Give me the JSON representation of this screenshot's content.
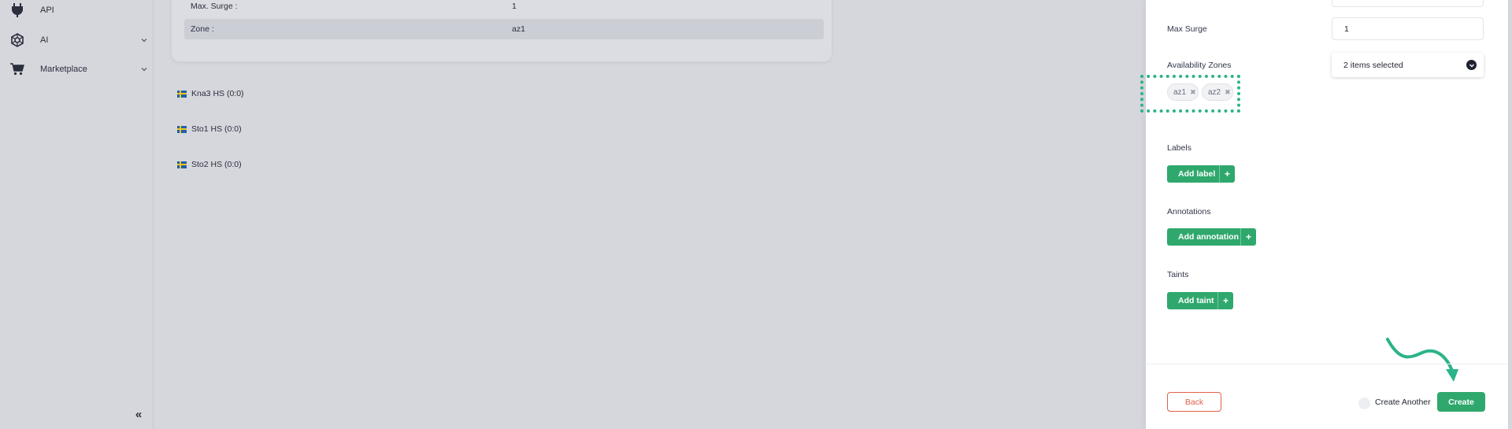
{
  "sidebar": {
    "items": [
      {
        "label": "API",
        "icon": "plug-icon",
        "has_submenu": false
      },
      {
        "label": "AI",
        "icon": "ai-network-icon",
        "has_submenu": true
      },
      {
        "label": "Marketplace",
        "icon": "cart-icon",
        "has_submenu": true
      }
    ],
    "collapse_glyph": "«"
  },
  "details": {
    "rows": [
      {
        "key": "Max. Surge :",
        "value": "1"
      },
      {
        "key": "Zone :",
        "value": "az1"
      }
    ]
  },
  "regions": [
    {
      "label": "Kna3 HS (0:0)"
    },
    {
      "label": "Sto1 HS (0:0)"
    },
    {
      "label": "Sto2 HS (0:0)"
    }
  ],
  "form": {
    "max_surge": {
      "label": "Max Surge",
      "value": "1"
    },
    "availability_zones": {
      "label": "Availability Zones",
      "selected_text": "2 items selected",
      "chips": [
        "az1",
        "az2"
      ]
    },
    "labels": {
      "label": "Labels",
      "button": "Add label"
    },
    "annotations": {
      "label": "Annotations",
      "button": "Add annotation"
    },
    "taints": {
      "label": "Taints",
      "button": "Add taint"
    },
    "footer": {
      "back": "Back",
      "create_another": "Create Another",
      "create": "Create"
    }
  },
  "colors": {
    "accent_green": "#2fa86d",
    "highlight_teal": "#2bb38a",
    "danger_orange": "#e2604a"
  }
}
